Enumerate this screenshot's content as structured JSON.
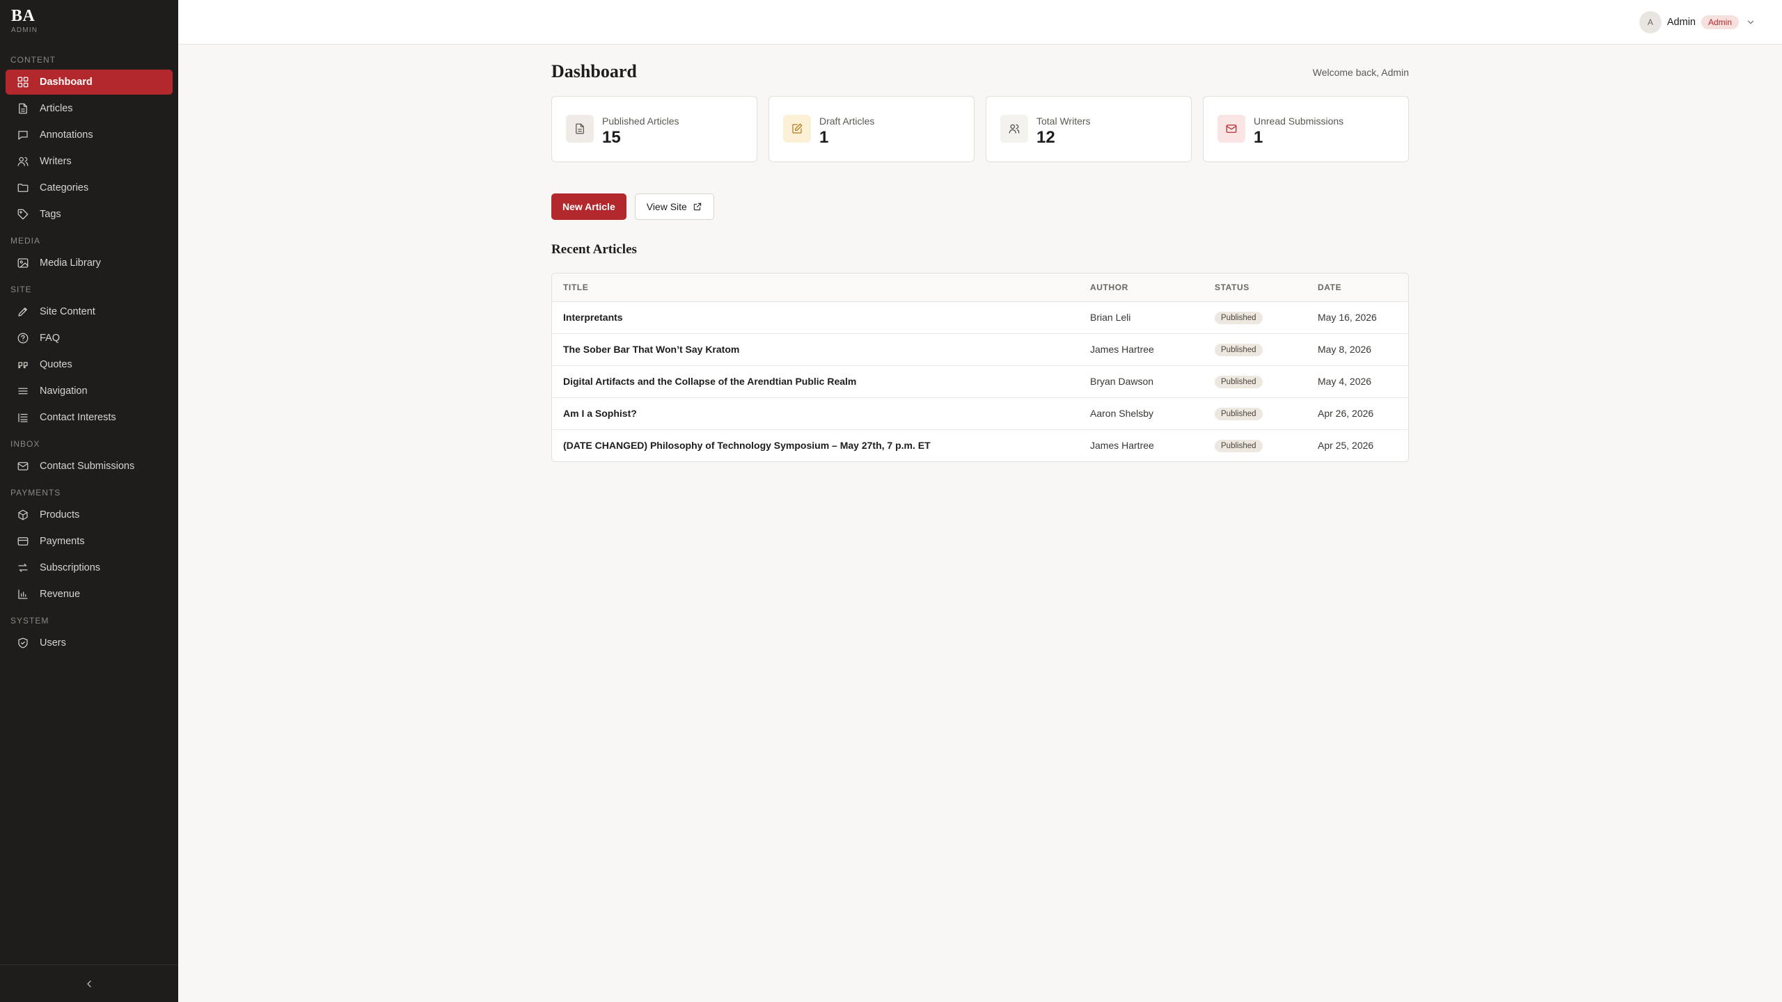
{
  "brand": {
    "logo": "BA",
    "subtitle": "ADMIN"
  },
  "sidebar": {
    "sections": [
      {
        "label": "CONTENT",
        "items": [
          {
            "label": "Dashboard",
            "icon": "dashboard-icon",
            "active": true
          },
          {
            "label": "Articles",
            "icon": "document-icon"
          },
          {
            "label": "Annotations",
            "icon": "comment-icon"
          },
          {
            "label": "Writers",
            "icon": "users-icon"
          },
          {
            "label": "Categories",
            "icon": "folder-icon"
          },
          {
            "label": "Tags",
            "icon": "tag-icon"
          }
        ]
      },
      {
        "label": "MEDIA",
        "items": [
          {
            "label": "Media Library",
            "icon": "image-icon"
          }
        ]
      },
      {
        "label": "SITE",
        "items": [
          {
            "label": "Site Content",
            "icon": "pencil-icon"
          },
          {
            "label": "FAQ",
            "icon": "help-circle-icon"
          },
          {
            "label": "Quotes",
            "icon": "quote-icon"
          },
          {
            "label": "Navigation",
            "icon": "menu-icon"
          },
          {
            "label": "Contact Interests",
            "icon": "list-icon"
          }
        ]
      },
      {
        "label": "INBOX",
        "items": [
          {
            "label": "Contact Submissions",
            "icon": "mail-icon"
          }
        ]
      },
      {
        "label": "PAYMENTS",
        "items": [
          {
            "label": "Products",
            "icon": "box-icon"
          },
          {
            "label": "Payments",
            "icon": "credit-card-icon"
          },
          {
            "label": "Subscriptions",
            "icon": "arrows-icon"
          },
          {
            "label": "Revenue",
            "icon": "bar-chart-icon"
          }
        ]
      },
      {
        "label": "SYSTEM",
        "items": [
          {
            "label": "Users",
            "icon": "shield-icon"
          }
        ]
      }
    ]
  },
  "topbar": {
    "avatar_initial": "A",
    "user_name": "Admin",
    "role": "Admin"
  },
  "header": {
    "title": "Dashboard",
    "welcome": "Welcome back, Admin"
  },
  "stats": [
    {
      "label": "Published Articles",
      "value": "15",
      "icon": "document-icon",
      "color": "#5d5852",
      "bg": "#efece7"
    },
    {
      "label": "Draft Articles",
      "value": "1",
      "icon": "edit-icon",
      "color": "#b7791f",
      "bg": "#fcf0d7"
    },
    {
      "label": "Total Writers",
      "value": "12",
      "icon": "users-icon",
      "color": "#4a4540",
      "bg": "#f4f2ef"
    },
    {
      "label": "Unread Submissions",
      "value": "1",
      "icon": "mail-icon",
      "color": "#b3282d",
      "bg": "#fbe5e4"
    }
  ],
  "actions": {
    "new_article": "New Article",
    "view_site": "View Site"
  },
  "recent": {
    "title": "Recent Articles",
    "columns": [
      "TITLE",
      "AUTHOR",
      "STATUS",
      "DATE"
    ],
    "rows": [
      {
        "title": "Interpretants",
        "author": "Brian Leli",
        "status": "Published",
        "date": "May 16, 2026"
      },
      {
        "title": "The Sober Bar That Won’t Say Kratom",
        "author": "James Hartree",
        "status": "Published",
        "date": "May 8, 2026"
      },
      {
        "title": "Digital Artifacts and the Collapse of the Arendtian Public Realm",
        "author": "Bryan Dawson",
        "status": "Published",
        "date": "May 4, 2026"
      },
      {
        "title": "Am I a Sophist?",
        "author": "Aaron Shelsby",
        "status": "Published",
        "date": "Apr 26, 2026"
      },
      {
        "title": "(DATE CHANGED) Philosophy of Technology Symposium – May 27th, 7 p.m. ET",
        "author": "James Hartree",
        "status": "Published",
        "date": "Apr 25, 2026"
      }
    ]
  }
}
